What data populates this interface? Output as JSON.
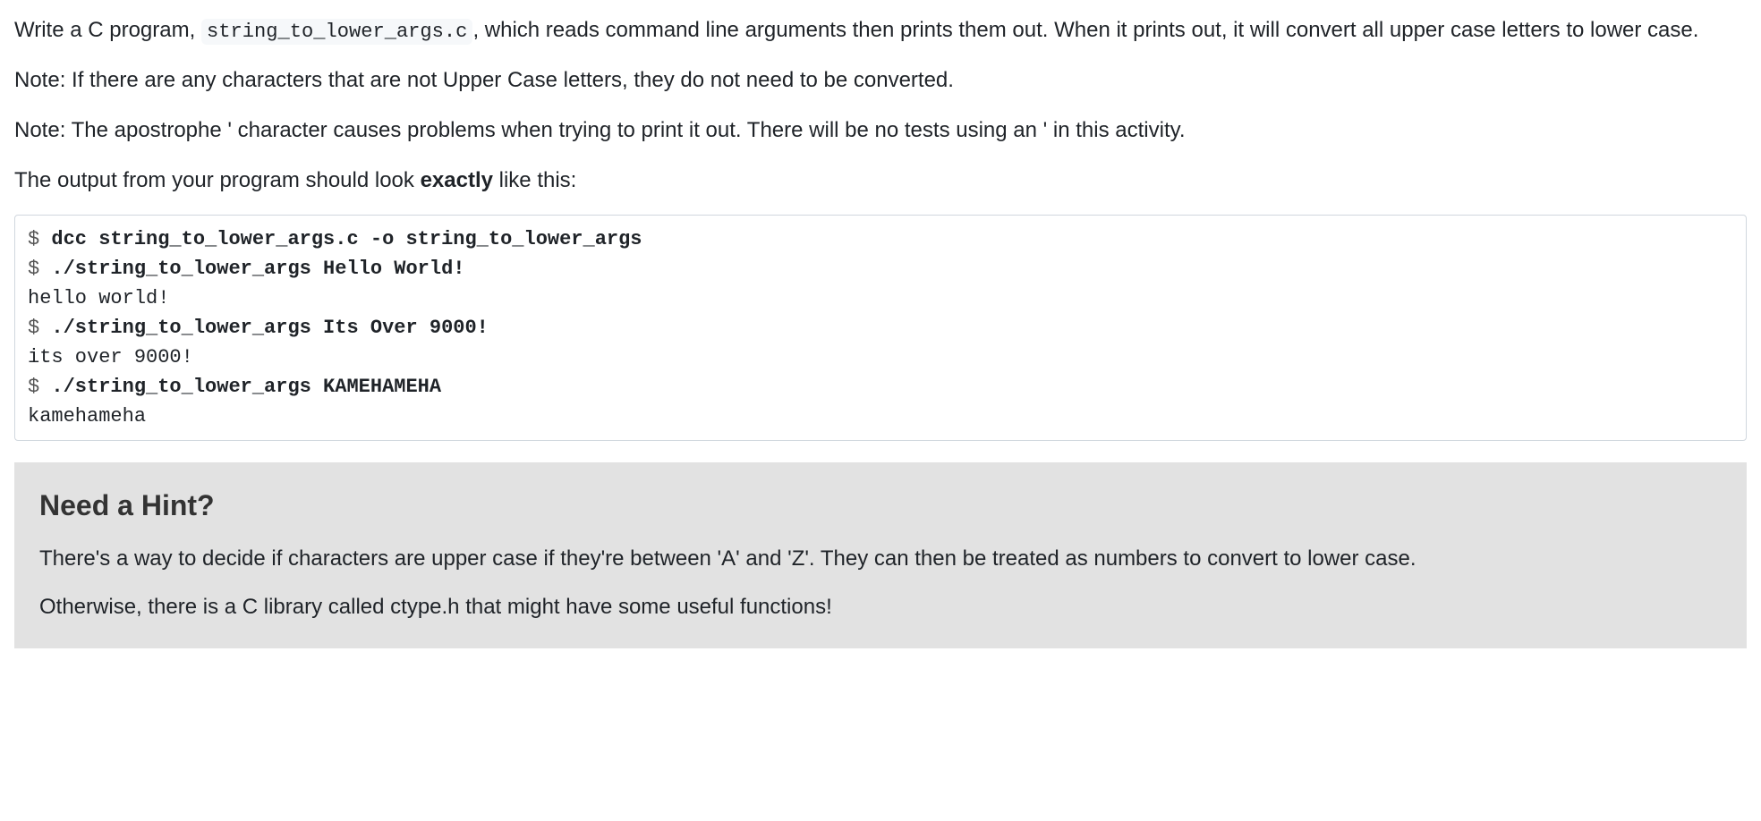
{
  "intro": {
    "p1_a": "Write a C program, ",
    "p1_code": "string_to_lower_args.c",
    "p1_b": ", which reads command line arguments then prints them out. When it prints out, it will convert all upper case letters to lower case.",
    "p2": "Note: If there are any characters that are not Upper Case letters, they do not need to be converted.",
    "p3": "Note: The apostrophe ' character causes problems when trying to print it out. There will be no tests using an ' in this activity.",
    "p4_a": "The output from your program should look ",
    "p4_bold": "exactly",
    "p4_b": " like this:"
  },
  "terminal": {
    "lines": [
      {
        "prompt": "$ ",
        "cmd": "dcc string_to_lower_args.c -o string_to_lower_args"
      },
      {
        "prompt": "$ ",
        "cmd": "./string_to_lower_args Hello World!"
      },
      {
        "out": "hello world!"
      },
      {
        "prompt": "$ ",
        "cmd": "./string_to_lower_args Its Over 9000!"
      },
      {
        "out": "its over 9000!"
      },
      {
        "prompt": "$ ",
        "cmd": "./string_to_lower_args KAMEHAMEHA"
      },
      {
        "out": "kamehameha"
      }
    ]
  },
  "hint": {
    "title": "Need a Hint?",
    "p1": "There's a way to decide if characters are upper case if they're between 'A' and 'Z'. They can then be treated as numbers to convert to lower case.",
    "p2": "Otherwise, there is a C library called ctype.h that might have some useful functions!"
  }
}
